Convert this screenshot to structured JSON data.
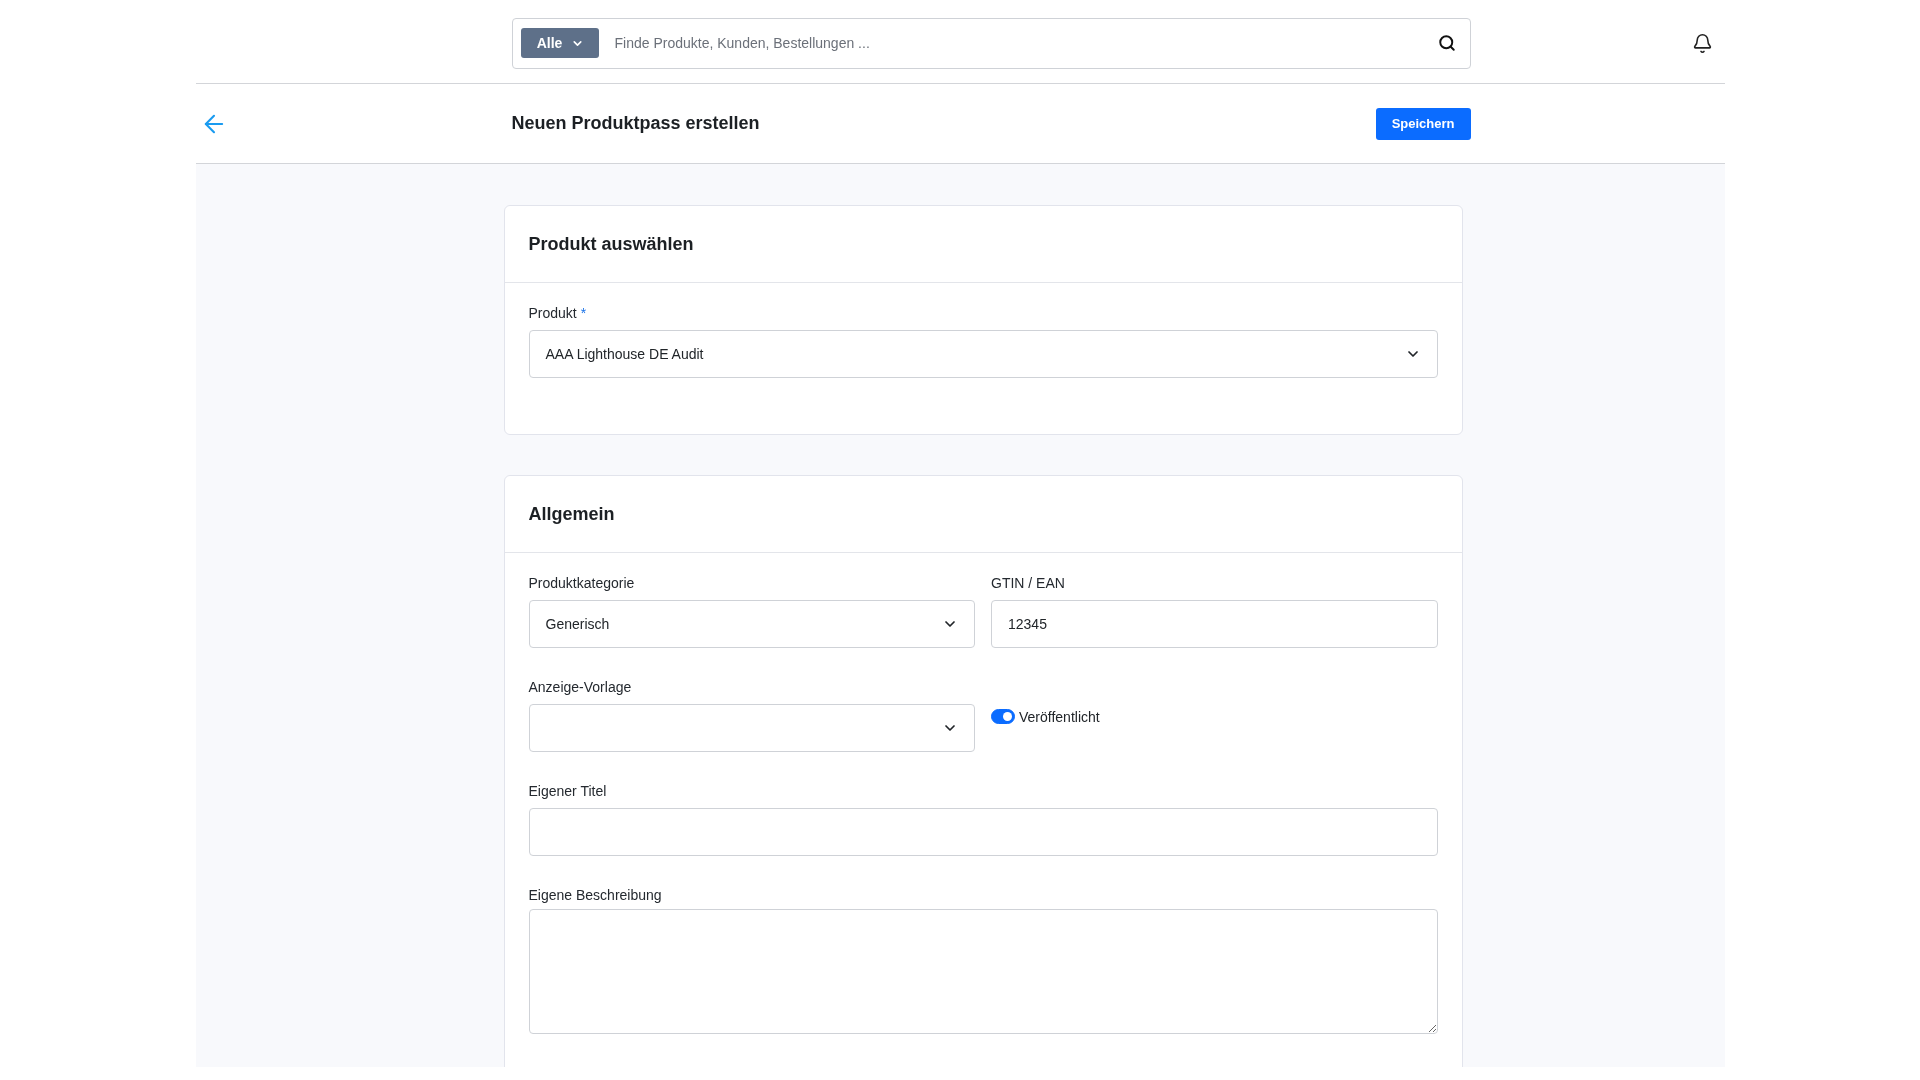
{
  "top_bar": {
    "search": {
      "scope": "Alle",
      "placeholder": "Finde Produkte, Kunden, Bestellungen ..."
    }
  },
  "page_header": {
    "title": "Neuen Produktpass erstellen",
    "save_button": "Speichern"
  },
  "sections": [
    {
      "title": "Produkt auswählen",
      "rows": [
        [
          {
            "kind": "select",
            "label": "Produkt",
            "required_mark": "*",
            "value": "AAA Lighthouse DE Audit"
          }
        ]
      ]
    },
    {
      "title": "Allgemein",
      "rows": [
        [
          {
            "kind": "select",
            "label": "Produktkategorie",
            "value": "Generisch"
          },
          {
            "kind": "text",
            "label": "GTIN / EAN",
            "value": "12345"
          }
        ],
        [
          {
            "kind": "select",
            "label": "Anzeige-Vorlage"
          },
          {
            "kind": "toggle",
            "label": "Veröffentlicht",
            "on": true
          }
        ],
        [
          {
            "kind": "text",
            "label": "Eigener Titel"
          }
        ],
        [
          {
            "kind": "textarea",
            "label": "Eigene Beschreibung"
          }
        ]
      ]
    }
  ]
}
